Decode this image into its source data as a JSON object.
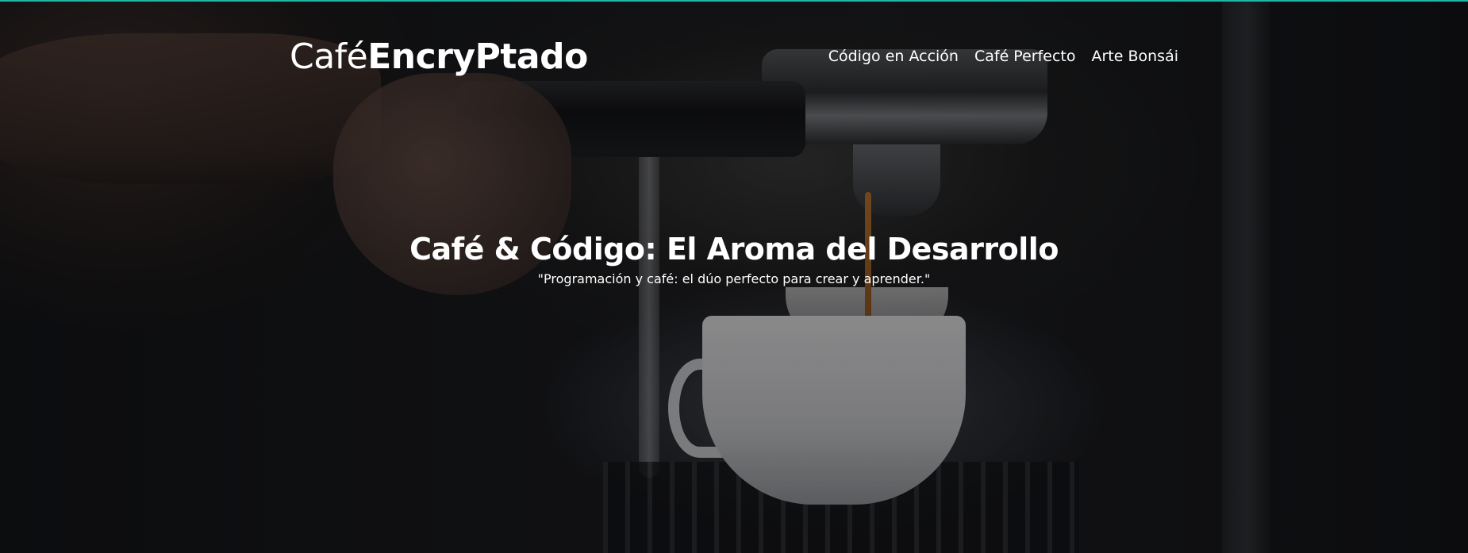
{
  "brand": {
    "name_light": "Café",
    "name_bold": "EncryPtado",
    "accent_color": "#1fb8a8"
  },
  "nav": {
    "items": [
      {
        "label": "Código en Acción"
      },
      {
        "label": "Café Perfecto"
      },
      {
        "label": "Arte Bonsái"
      }
    ]
  },
  "hero": {
    "title": "Café & Código: El Aroma del Desarrollo",
    "subtitle": "\"Programación y café: el dúo perfecto para crear y aprender.\"",
    "background_image": "espresso-machine-pouring-coffee"
  }
}
